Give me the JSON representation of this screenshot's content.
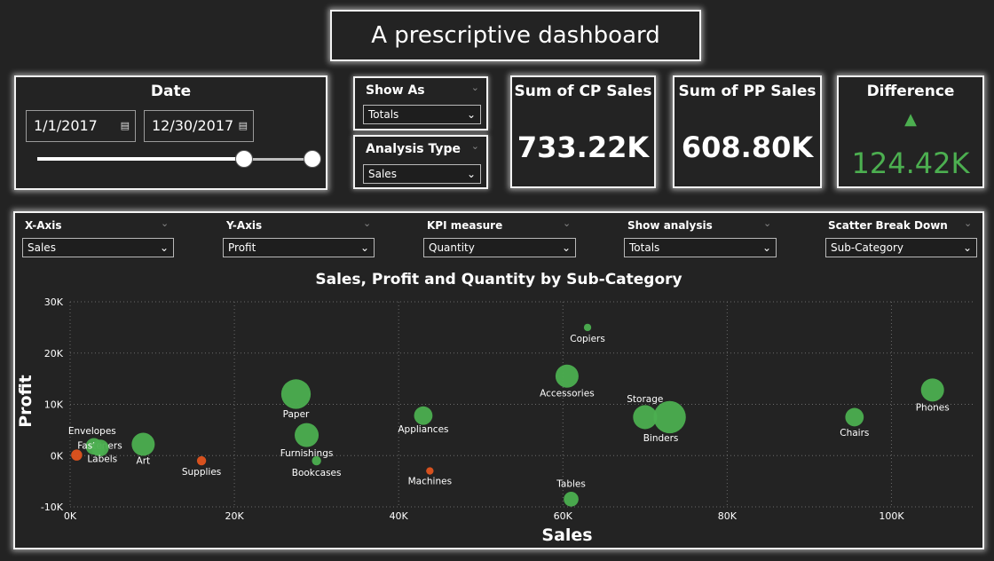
{
  "header": {
    "title": "A prescriptive dashboard"
  },
  "date_filter": {
    "title": "Date",
    "start": "1/1/2017",
    "end": "12/30/2017",
    "calendar_icon": "calendar-icon",
    "range_start_fraction": 0.75,
    "range_end_fraction": 1.0
  },
  "slicers": {
    "show_as": {
      "label": "Show As",
      "value": "Totals"
    },
    "analysis_type": {
      "label": "Analysis Type",
      "value": "Sales"
    }
  },
  "kpis": {
    "cp_sales": {
      "title": "Sum of CP Sales",
      "value": "733.22K"
    },
    "pp_sales": {
      "title": "Sum of PP Sales",
      "value": "608.80K"
    },
    "difference": {
      "title": "Difference",
      "value": "124.42K",
      "indicator": "up-triangle-icon",
      "color": "#4caf50"
    }
  },
  "filters": [
    {
      "label": "X-Axis",
      "value": "Sales"
    },
    {
      "label": "Y-Axis",
      "value": "Profit"
    },
    {
      "label": "KPI measure",
      "value": "Quantity"
    },
    {
      "label": "Show analysis",
      "value": "Totals"
    },
    {
      "label": "Scatter Break Down",
      "value": "Sub-Category"
    }
  ],
  "colors": {
    "positive": "#4caf50",
    "negative": "#e2541f",
    "background": "#232323"
  },
  "chart_data": {
    "type": "scatter",
    "title": "Sales, Profit and Quantity by Sub-Category",
    "xlabel": "Sales",
    "ylabel": "Profit",
    "xlim": [
      0,
      110000
    ],
    "ylim": [
      -10000,
      30000
    ],
    "x_ticks": [
      0,
      20000,
      40000,
      60000,
      80000,
      100000
    ],
    "x_tick_labels": [
      "0K",
      "20K",
      "40K",
      "60K",
      "80K",
      "100K"
    ],
    "y_ticks": [
      -10000,
      0,
      10000,
      20000,
      30000
    ],
    "y_tick_labels": [
      "-10K",
      "0K",
      "10K",
      "20K",
      "30K"
    ],
    "grid": true,
    "points": [
      {
        "label": "Envelopes",
        "x": 2900,
        "y": 1800,
        "size": 1.8,
        "color": "positive"
      },
      {
        "label": "Fasteners",
        "x": 3400,
        "y": 1200,
        "size": 1.4,
        "color": "positive"
      },
      {
        "label": "Labels",
        "x": 3700,
        "y": 1500,
        "size": 1.8,
        "color": "positive"
      },
      {
        "label": "",
        "x": 800,
        "y": 100,
        "size": 1.2,
        "color": "negative"
      },
      {
        "label": "Art",
        "x": 8900,
        "y": 2200,
        "size": 2.5,
        "color": "positive"
      },
      {
        "label": "Supplies",
        "x": 16000,
        "y": -1000,
        "size": 1.0,
        "color": "negative"
      },
      {
        "label": "Paper",
        "x": 27500,
        "y": 12000,
        "size": 3.2,
        "color": "positive"
      },
      {
        "label": "Furnishings",
        "x": 28800,
        "y": 4000,
        "size": 2.6,
        "color": "positive"
      },
      {
        "label": "Bookcases",
        "x": 30000,
        "y": -1000,
        "size": 1.0,
        "color": "positive"
      },
      {
        "label": "Appliances",
        "x": 43000,
        "y": 7800,
        "size": 2.0,
        "color": "positive"
      },
      {
        "label": "Machines",
        "x": 43800,
        "y": -3000,
        "size": 0.8,
        "color": "negative"
      },
      {
        "label": "Accessories",
        "x": 60500,
        "y": 15500,
        "size": 2.5,
        "color": "positive"
      },
      {
        "label": "Copiers",
        "x": 63000,
        "y": 25000,
        "size": 0.8,
        "color": "positive"
      },
      {
        "label": "Tables",
        "x": 61000,
        "y": -8500,
        "size": 1.6,
        "color": "positive"
      },
      {
        "label": "Storage",
        "x": 70000,
        "y": 7500,
        "size": 2.6,
        "color": "positive"
      },
      {
        "label": "Binders",
        "x": 73000,
        "y": 7500,
        "size": 3.5,
        "color": "positive"
      },
      {
        "label": "Chairs",
        "x": 95500,
        "y": 7500,
        "size": 2.0,
        "color": "positive"
      },
      {
        "label": "Phones",
        "x": 105000,
        "y": 12800,
        "size": 2.5,
        "color": "positive"
      }
    ]
  }
}
